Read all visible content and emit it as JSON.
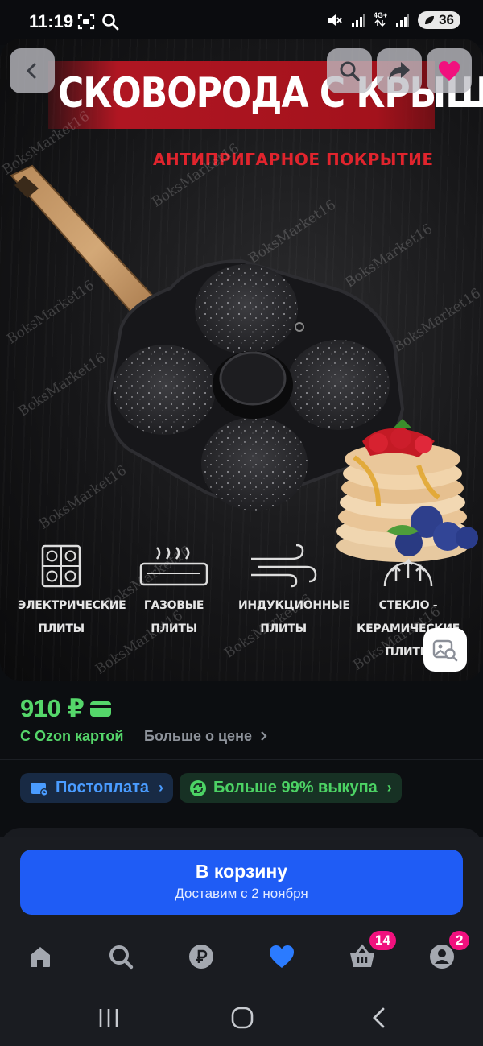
{
  "status_bar": {
    "time": "11:19",
    "network_label_top": "4G+",
    "battery": "36"
  },
  "product": {
    "title": "СКОВОРОДА С КРЫШКОЙ",
    "subtitle": "АНТИПРИГАРНОЕ ПОКРЫТИЕ",
    "watermark": "BoksMarket16",
    "features": [
      {
        "icon": "electric-stove-icon",
        "line1": "ЭЛЕКТРИЧЕСКИЕ",
        "line2": "ПЛИТЫ"
      },
      {
        "icon": "gas-stove-icon",
        "line1": "ГАЗОВЫЕ",
        "line2": "ПЛИТЫ"
      },
      {
        "icon": "induction-icon",
        "line1": "ИНДУКЦИОННЫЕ",
        "line2": "ПЛИТЫ"
      },
      {
        "icon": "glass-ceramic-icon",
        "line1": "СТЕКЛО -",
        "line2": "КЕРАМИЧЕСКИЕ ПЛИТЫ"
      }
    ]
  },
  "price": {
    "value": "910 ₽",
    "caption": "С Ozon картой",
    "more": "Больше о цене"
  },
  "badges": {
    "postpay": "Постоплата",
    "buyout": "Больше 99% выкупа"
  },
  "cart": {
    "label": "В корзину",
    "delivery": "Доставим с 2 ноября"
  },
  "tabbar": {
    "cart_count": "14",
    "profile_count": "2"
  },
  "colors": {
    "accent_green": "#55d66a",
    "accent_blue": "#1f5cf5",
    "badge_pink": "#f1117e"
  }
}
